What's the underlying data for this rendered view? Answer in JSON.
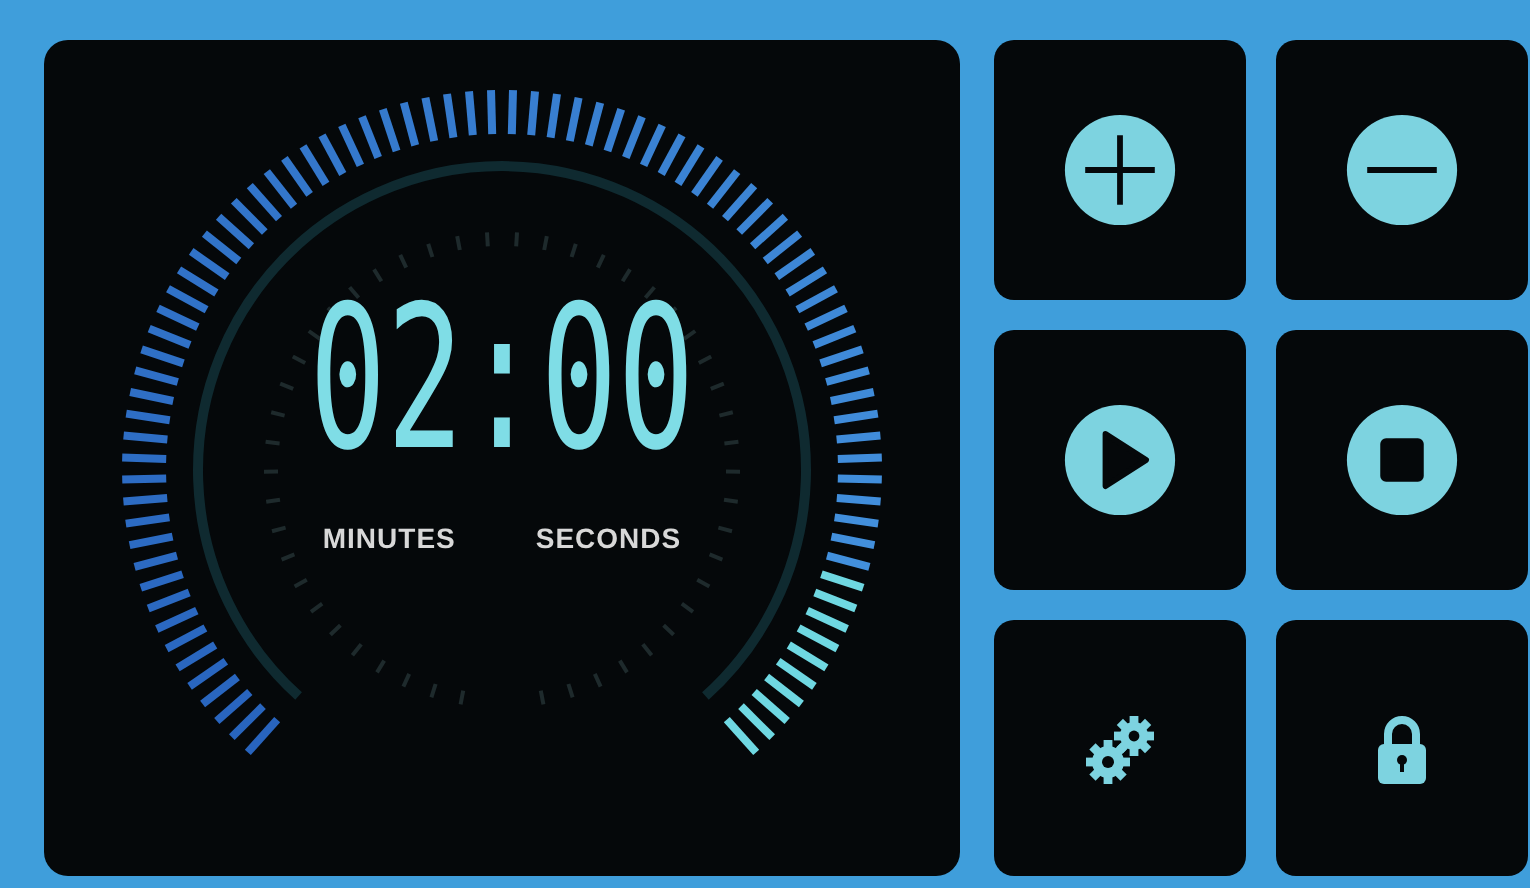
{
  "timer": {
    "time": "02:00",
    "labels": [
      "MINUTES",
      "SECONDS"
    ]
  },
  "buttons": [
    {
      "kind": "plus"
    },
    {
      "kind": "minus"
    },
    {
      "kind": "play"
    },
    {
      "kind": "stop"
    },
    {
      "kind": "settings"
    },
    {
      "kind": "lock"
    }
  ]
}
